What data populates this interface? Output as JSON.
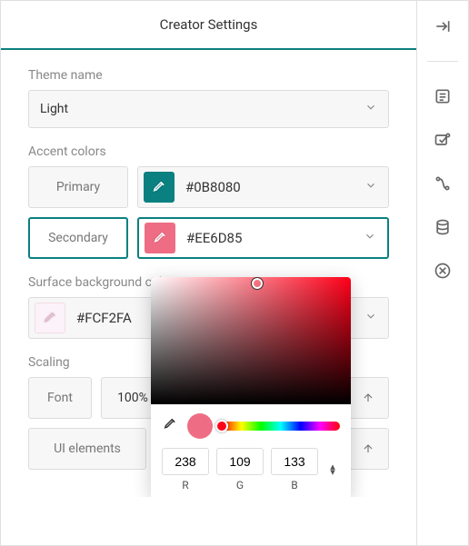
{
  "header": {
    "title": "Creator Settings"
  },
  "themeName": {
    "label": "Theme name",
    "value": "Light"
  },
  "accentColors": {
    "label": "Accent colors",
    "primary": {
      "label": "Primary",
      "hex": "#0B8080",
      "swatch": "#0B8080"
    },
    "secondary": {
      "label": "Secondary",
      "hex": "#EE6D85",
      "swatch": "#EE6D85"
    }
  },
  "surfaceBackground": {
    "label": "Surface background colors",
    "hex": "#FCF2FA",
    "swatch": "#FCF2FA"
  },
  "scaling": {
    "label": "Scaling",
    "font": {
      "label": "Font",
      "value": "100%"
    },
    "uiElements": {
      "label": "UI elements"
    }
  },
  "colorPicker": {
    "r": "238",
    "g": "109",
    "b": "133",
    "rLabel": "R",
    "gLabel": "G",
    "bLabel": "B",
    "currentSwatch": "#EE6D85"
  },
  "sidebar": {
    "collapse": "collapse-icon",
    "list": "list-icon",
    "design": "design-icon",
    "logic": "logic-icon",
    "data": "data-icon",
    "close": "close-icon"
  }
}
